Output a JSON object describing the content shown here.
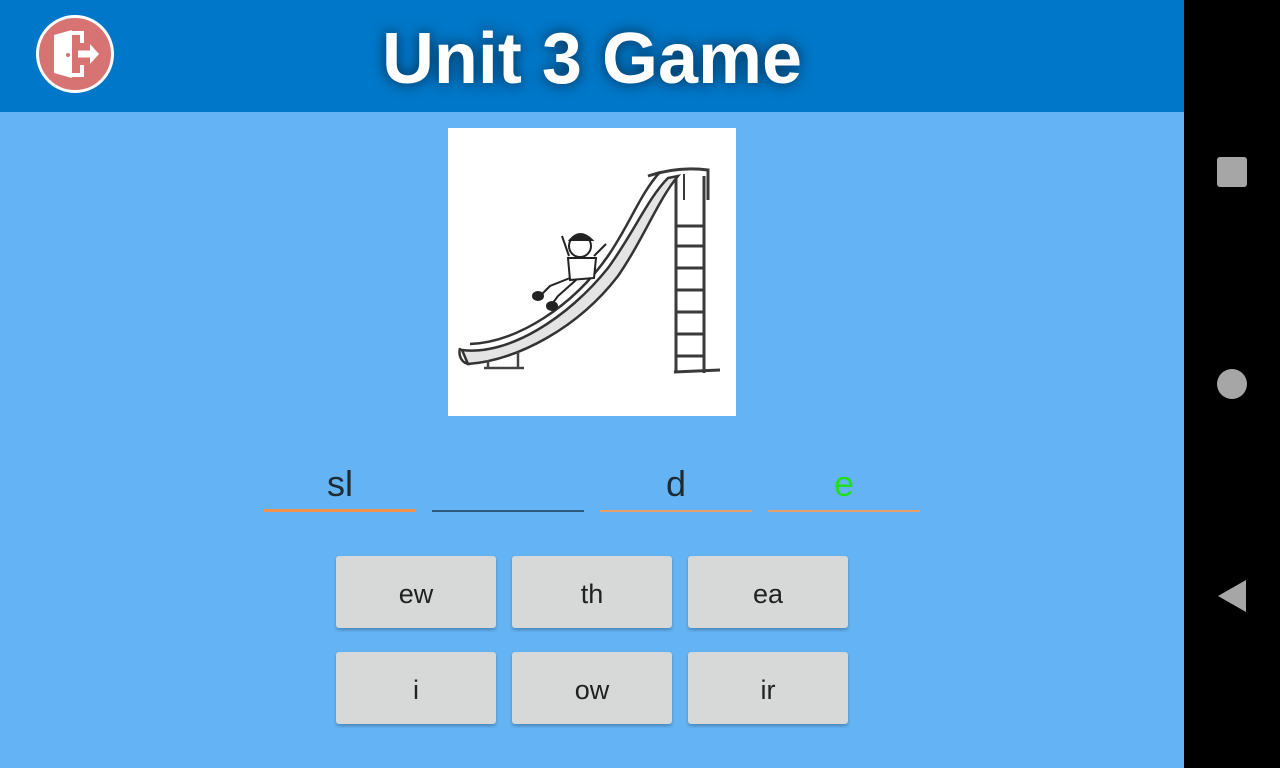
{
  "header": {
    "title": "Unit 3 Game",
    "exit_icon": "door-exit-icon"
  },
  "picture": {
    "icon": "playground-slide-illustration"
  },
  "word_slots": [
    {
      "text": "sl",
      "color": "#1e2b33",
      "state": "active"
    },
    {
      "text": "",
      "color": "#1e2b33",
      "state": "empty"
    },
    {
      "text": "d",
      "color": "#1e2b33",
      "state": "filled"
    },
    {
      "text": "e",
      "color": "#22dd22",
      "state": "filled"
    }
  ],
  "choices": [
    {
      "label": "ew"
    },
    {
      "label": "th"
    },
    {
      "label": "ea"
    },
    {
      "label": "i"
    },
    {
      "label": "ow"
    },
    {
      "label": "ir"
    }
  ],
  "navbar": {
    "recents_icon": "square-recents-icon",
    "home_icon": "circle-home-icon",
    "back_icon": "triangle-back-icon"
  },
  "colors": {
    "header": "#0077c8",
    "background": "#64b4f5",
    "exit_button": "#d87373",
    "accent_underline": "#f0934f",
    "choice_button": "#d7d9d9"
  }
}
